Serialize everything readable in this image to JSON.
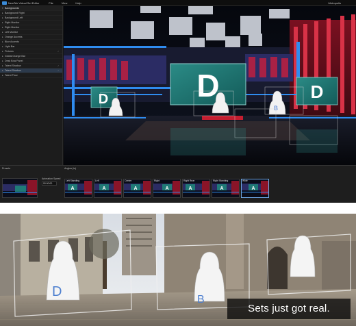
{
  "app": {
    "title": "NewTek Virtual Set Editor",
    "menu": [
      "File",
      "View",
      "Help"
    ],
    "workspace_label": "Metropolis"
  },
  "layers": [
    {
      "label": "Backgrounds",
      "twisty": "▾",
      "head": true
    },
    {
      "label": "Background Right",
      "twisty": "▸"
    },
    {
      "label": "Background Left",
      "twisty": "▸"
    },
    {
      "label": "Right Monitor",
      "twisty": "▸"
    },
    {
      "label": "Right Monitor",
      "twisty": "▸"
    },
    {
      "label": "Left Monitor",
      "twisty": "▸"
    },
    {
      "label": "Orange Accents",
      "twisty": "▸"
    },
    {
      "label": "Blue Accents",
      "twisty": "▸"
    },
    {
      "label": "Light Bar",
      "twisty": "▸"
    },
    {
      "label": "Fixtures",
      "twisty": "▸",
      "visible": true
    },
    {
      "label": "Global Orange Bar",
      "twisty": "▸"
    },
    {
      "label": "Desk Bow Panel",
      "twisty": "▸"
    },
    {
      "label": "Talent Shadow",
      "twisty": "▸",
      "visible": true
    },
    {
      "label": "Talent Shadow",
      "twisty": "▸",
      "visible": true,
      "selected": true
    },
    {
      "label": "Talent Floor",
      "twisty": "▸"
    }
  ],
  "viewport": {
    "monitor_letter": "D",
    "talent_letter_b": "B"
  },
  "bottom": {
    "presets_label": "Presets",
    "angles_label": "Angles (in)",
    "speed_label": "Animation Speed",
    "speed_value": "00:00:00",
    "angles": [
      {
        "label": "Left Standing",
        "letter": "A"
      },
      {
        "label": "Left",
        "letter": "A"
      },
      {
        "label": "Center",
        "letter": "A"
      },
      {
        "label": "Right",
        "letter": "A"
      },
      {
        "label": "Right Rear",
        "letter": "A"
      },
      {
        "label": "Right Standing",
        "letter": "A"
      },
      {
        "label": "Wide",
        "letter": "A",
        "selected": true
      }
    ]
  },
  "photo": {
    "tagline": "Sets just got real.",
    "letter_d": "D",
    "letter_b": "B"
  },
  "colors": {
    "app_bg": "#151515",
    "selection": "#2c3a4c",
    "set_blue": "#2a74c8",
    "set_red": "#c0223a",
    "monitor_teal": "#1f7a77"
  }
}
